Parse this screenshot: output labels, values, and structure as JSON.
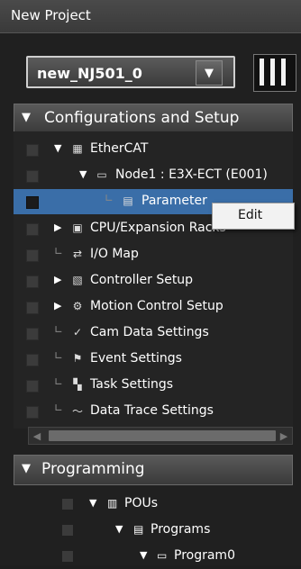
{
  "window": {
    "title": "New Project"
  },
  "controller": {
    "selected": "new_NJ501_0"
  },
  "config_section": {
    "title": "Configurations and Setup"
  },
  "tree": [
    {
      "label": "EtherCAT",
      "icon": "ethercat-icon",
      "glyph": "▦",
      "expander": "▼"
    },
    {
      "label": "Node1 : E3X-ECT (E001)",
      "icon": "node-icon",
      "glyph": "▭",
      "expander": "▼"
    },
    {
      "label": "Parameter",
      "icon": "parameter-icon",
      "glyph": "▤",
      "expander": ""
    },
    {
      "label": "CPU/Expansion Racks",
      "icon": "rack-icon",
      "glyph": "▣",
      "expander": "▶"
    },
    {
      "label": "I/O Map",
      "icon": "io-map-icon",
      "glyph": "⇄",
      "expander": ""
    },
    {
      "label": "Controller Setup",
      "icon": "controller-setup-icon",
      "glyph": "▧",
      "expander": "▶"
    },
    {
      "label": "Motion Control Setup",
      "icon": "gear-icon",
      "glyph": "⚙",
      "expander": "▶"
    },
    {
      "label": "Cam Data Settings",
      "icon": "cam-icon",
      "glyph": "✓",
      "expander": ""
    },
    {
      "label": "Event Settings",
      "icon": "flag-icon",
      "glyph": "⚑",
      "expander": ""
    },
    {
      "label": "Task Settings",
      "icon": "task-icon",
      "glyph": "▚",
      "expander": ""
    },
    {
      "label": "Data Trace Settings",
      "icon": "trace-icon",
      "glyph": "〜",
      "expander": ""
    }
  ],
  "context_menu": {
    "item": "Edit"
  },
  "programming_section": {
    "title": "Programming"
  },
  "programming_tree": [
    {
      "label": "POUs",
      "icon": "pous-icon",
      "glyph": "▥"
    },
    {
      "label": "Programs",
      "icon": "programs-icon",
      "glyph": "▤"
    },
    {
      "label": "Program0",
      "icon": "program-icon",
      "glyph": "▭"
    }
  ],
  "colors": {
    "selection": "#3a6ea8",
    "background": "#1e1e1e"
  }
}
